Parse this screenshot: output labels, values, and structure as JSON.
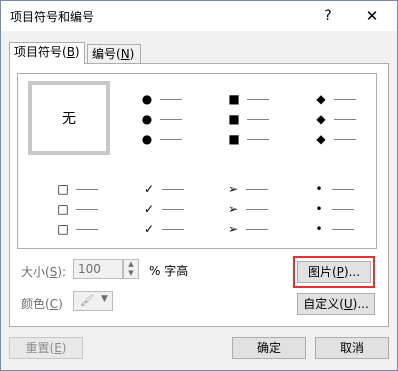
{
  "window": {
    "title": "项目符号和编号",
    "help_label": "?",
    "close_label": "✕"
  },
  "tabs": [
    {
      "label": "项目符号(",
      "key": "B",
      "end": ")"
    },
    {
      "label": "编号(",
      "key": "N",
      "end": ")"
    }
  ],
  "gallery": {
    "none_label": "无",
    "styles": [
      {
        "name": "none"
      },
      {
        "name": "filled-circle",
        "symbol": "●"
      },
      {
        "name": "filled-square",
        "symbol": "■"
      },
      {
        "name": "filled-diamond",
        "symbol": "◆"
      },
      {
        "name": "hollow-square",
        "symbol": "□"
      },
      {
        "name": "checkmark",
        "symbol": "✓"
      },
      {
        "name": "arrowhead",
        "symbol": "➢"
      },
      {
        "name": "small-dot",
        "symbol": "•"
      }
    ]
  },
  "size": {
    "label": "大小(",
    "key": "S",
    "end": "):",
    "value": "100",
    "unit": "% 字高"
  },
  "color": {
    "label": "颜色(",
    "key": "C",
    "end": ")"
  },
  "buttons": {
    "picture": {
      "label": "图片(",
      "key": "P",
      "end": ")..."
    },
    "custom": {
      "label": "自定义(",
      "key": "U",
      "end": ")..."
    },
    "reset": {
      "label": "重置(",
      "key": "E",
      "end": ")"
    },
    "ok": "确定",
    "cancel": "取消"
  },
  "icons": {
    "help": "help-icon",
    "close": "close-icon",
    "spin_up": "triangle-up-icon",
    "spin_down": "triangle-down-icon",
    "paint": "paint-bucket-icon",
    "dropdown": "triangle-down-icon"
  },
  "colors": {
    "selection_outline": "#e53131",
    "selected_cell_border": "#c8c8c8"
  }
}
